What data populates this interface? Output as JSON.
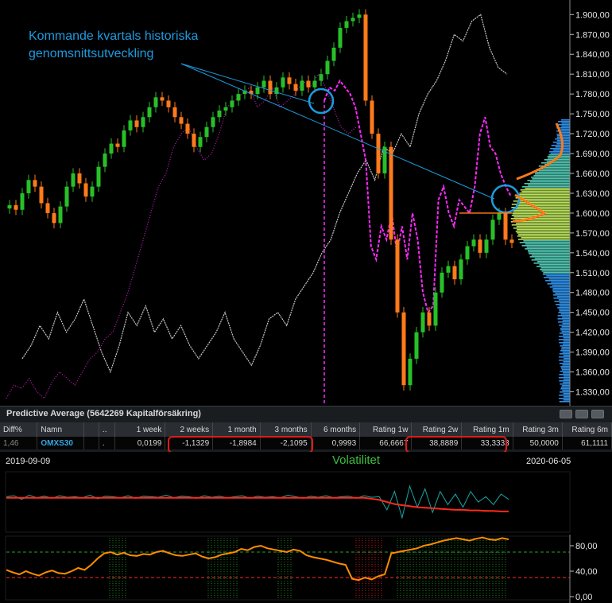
{
  "annotation": {
    "line1": "Kommande kvartals historiska",
    "line2": "genomsnittsutveckling",
    "color": "#1e9be0"
  },
  "chart_data": [
    {
      "type": "line",
      "title": "",
      "y_axis": {
        "min": 1315,
        "max": 1910,
        "ticks": [
          "1.330,00",
          "1.360,00",
          "1.390,00",
          "1.420,00",
          "1.450,00",
          "1.480,00",
          "1.510,00",
          "1.540,00",
          "1.570,00",
          "1.600,00",
          "1.630,00",
          "1.660,00",
          "1.690,00",
          "1.720,00",
          "1.750,00",
          "1.780,00",
          "1.810,00",
          "1.840,00",
          "1.870,00",
          "1.900,00"
        ]
      },
      "series": [
        {
          "kind": "candles",
          "color_up": "#28c028",
          "color_down": "#ff7a1a",
          "close": [
            1612,
            1605,
            1630,
            1650,
            1640,
            1615,
            1600,
            1585,
            1610,
            1640,
            1660,
            1645,
            1625,
            1640,
            1670,
            1690,
            1705,
            1700,
            1725,
            1740,
            1730,
            1745,
            1760,
            1775,
            1770,
            1760,
            1745,
            1735,
            1720,
            1700,
            1715,
            1730,
            1745,
            1755,
            1760,
            1770,
            1780,
            1785,
            1780,
            1790,
            1800,
            1780,
            1790,
            1805,
            1795,
            1785,
            1800,
            1790,
            1800,
            1810,
            1830,
            1850,
            1880,
            1890,
            1895,
            1900,
            1770,
            1720,
            1660,
            1700,
            1560,
            1450,
            1340,
            1380,
            1420,
            1450,
            1430,
            1480,
            1510,
            1520,
            1500,
            1530,
            1550,
            1560,
            1540,
            1560,
            1590,
            1600,
            1560,
            1555
          ]
        },
        {
          "kind": "line",
          "color": "#c020c0",
          "style": "dotted",
          "values": [
            1320,
            1340,
            1335,
            1350,
            1330,
            1320,
            1345,
            1360,
            1350,
            1340,
            1360,
            1380,
            1390,
            1410,
            1420,
            1450,
            1480,
            1520,
            1560,
            1600,
            1640,
            1660,
            1700,
            1720,
            1730,
            1700,
            1680,
            1690,
            1720,
            1760,
            1770,
            1780,
            1790,
            1760,
            1770,
            1790,
            1760,
            1770,
            1780,
            1800,
            1790,
            1810,
            1790,
            1760,
            1730,
            1720,
            1730
          ]
        },
        {
          "kind": "line",
          "color": "#ff2aff",
          "style": "dashed",
          "values": [
            1770,
            1790,
            1785,
            1800,
            1790,
            1780,
            1760,
            1720,
            1680,
            1550,
            1530,
            1580,
            1560,
            1600,
            1540,
            1580,
            1530,
            1600,
            1560,
            1480,
            1450,
            1460,
            1620,
            1640,
            1600,
            1580,
            1620,
            1610,
            1600,
            1640,
            1720,
            1745,
            1700,
            1690,
            1660,
            1640,
            1625
          ]
        },
        {
          "kind": "line",
          "color": "#c8c8c8",
          "values": [
            1380,
            1400,
            1430,
            1410,
            1450,
            1420,
            1440,
            1470,
            1430,
            1390,
            1360,
            1400,
            1450,
            1430,
            1460,
            1420,
            1440,
            1410,
            1430,
            1400,
            1380,
            1400,
            1420,
            1450,
            1410,
            1390,
            1370,
            1400,
            1440,
            1450,
            1430,
            1470,
            1490,
            1510,
            1540,
            1560,
            1600,
            1630,
            1660,
            1680,
            1650,
            1700,
            1690,
            1720,
            1700,
            1750,
            1780,
            1800,
            1830,
            1870,
            1860,
            1890,
            1900,
            1850,
            1820,
            1810
          ]
        }
      ],
      "current_marker": 1600,
      "distribution_color": "#2f8fe6"
    },
    {
      "type": "table",
      "title": "Predictive Average (5642269  Kapitalförsäkring)",
      "columns": [
        "Diff%",
        "Namn",
        "",
        "..",
        "1 week",
        "2 weeks",
        "1 month",
        "3 months",
        "6 months",
        "Rating 1w",
        "Rating 2w",
        "Rating 1m",
        "Rating 3m",
        "Rating 6m"
      ],
      "rows": [
        [
          "1,46",
          "OMXS30",
          "",
          ".",
          "0,0199",
          "-1,1329",
          "-1,8984",
          "-2,1095",
          "0,9993",
          "66,6667",
          "38,8889",
          "33,3333",
          "50,0000",
          "61,1111"
        ]
      ]
    },
    {
      "type": "line",
      "title": "Volatilitet",
      "x_start": "2019-09-09",
      "x_end": "2020-06-05",
      "series": [
        {
          "color": "#1aa6a6",
          "values": [
            60,
            62,
            55,
            63,
            58,
            61,
            57,
            62,
            59,
            60,
            58,
            63,
            56,
            61,
            60,
            58,
            62,
            57,
            61,
            60,
            59,
            63,
            58,
            61,
            60,
            57,
            62,
            59,
            61,
            58,
            60,
            62,
            57,
            61,
            59,
            60,
            58,
            63,
            60,
            57,
            61,
            59,
            62,
            58,
            60,
            61,
            57,
            62,
            59,
            60,
            35,
            70,
            20,
            80,
            40,
            75,
            30,
            70,
            45,
            65,
            40,
            70,
            50,
            60,
            45,
            65,
            55
          ]
        },
        {
          "color": "#ff2a1a",
          "values": [
            58,
            58,
            58,
            58,
            58,
            58,
            58,
            58,
            58,
            58,
            58,
            58,
            58,
            58,
            58,
            58,
            58,
            58,
            58,
            58,
            58,
            58,
            58,
            58,
            58,
            58,
            58,
            58,
            58,
            58,
            58,
            58,
            58,
            58,
            58,
            58,
            58,
            58,
            58,
            58,
            58,
            58,
            58,
            58,
            58,
            58,
            58,
            58,
            56,
            54,
            50,
            46,
            44,
            42,
            40,
            39,
            38,
            37,
            36,
            35,
            35,
            34,
            34,
            33,
            33,
            32,
            32
          ]
        }
      ]
    },
    {
      "type": "line",
      "title": "",
      "y_axis": {
        "min": 0,
        "max": 100,
        "ticks": [
          "0,00",
          "40,00",
          "80,00"
        ]
      },
      "thresholds": [
        {
          "value": 30,
          "color": "#ff2a2a"
        },
        {
          "value": 70,
          "color": "#2aa02a"
        }
      ],
      "series": [
        {
          "color": "#ff8c00",
          "values": [
            42,
            38,
            35,
            40,
            36,
            33,
            38,
            41,
            37,
            36,
            40,
            45,
            42,
            50,
            60,
            68,
            70,
            66,
            69,
            65,
            64,
            67,
            66,
            70,
            72,
            68,
            65,
            64,
            66,
            68,
            63,
            60,
            62,
            66,
            68,
            70,
            75,
            73,
            78,
            80,
            76,
            74,
            72,
            70,
            74,
            72,
            65,
            62,
            60,
            58,
            55,
            52,
            50,
            28,
            26,
            30,
            27,
            32,
            35,
            68,
            70,
            72,
            74,
            76,
            80,
            82,
            85,
            88,
            90,
            92,
            90,
            88,
            91,
            93,
            90,
            89,
            92,
            90
          ]
        }
      ]
    }
  ]
}
